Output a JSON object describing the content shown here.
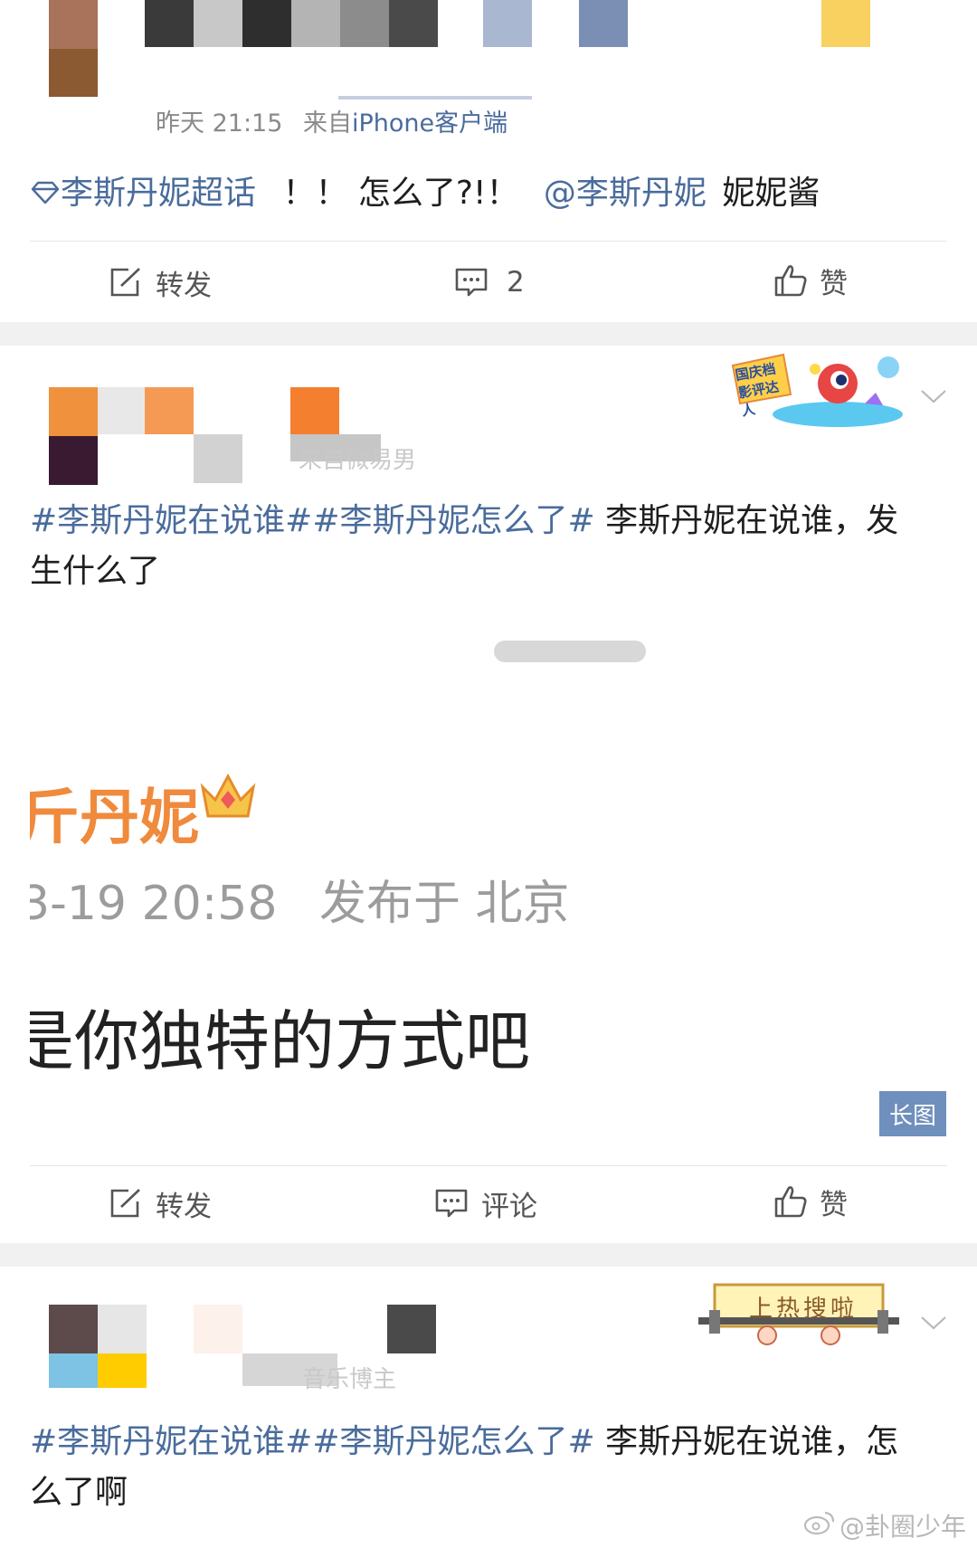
{
  "post1": {
    "meta_time": "昨天 21:15",
    "meta_from": "来自",
    "meta_client": "iPhone客户端",
    "supertopic_label": "李斯丹妮超话",
    "text_plain": "！！ 怎么了?!！",
    "mention": "@李斯丹妮",
    "text_tail": "妮妮酱",
    "actions": {
      "repost_label": "转发",
      "comment_count": "2",
      "like_label": "赞"
    }
  },
  "post2": {
    "sticker_text": "国庆档 影评达人",
    "blurred_source": "来自微易男",
    "hashtag1": "#李斯丹妮在说谁#",
    "hashtag2": "#李斯丹妮怎么了#",
    "text_line1": " 李斯丹妮在说谁，发",
    "text_line2": "生什么了",
    "embedded_image": {
      "name_fragment": "斤丹妮",
      "timestamp_fragment": "3-19 20:58",
      "location_fragment": "发布于 北京",
      "body_fragment": "是你独特的方式吧"
    },
    "long_image_badge": "长图",
    "actions": {
      "repost_label": "转发",
      "comment_label": "评论",
      "like_label": "赞"
    }
  },
  "post3": {
    "sticker_text": "上热搜啦",
    "blurred_source": "音乐博主",
    "hashtag1": "#李斯丹妮在说谁#",
    "hashtag2": "#李斯丹妮怎么了#",
    "text_line1": " 李斯丹妮在说谁，怎",
    "text_line2": "么了啊"
  },
  "watermark": "@卦圈少年",
  "colors": {
    "link_blue": "#4a6c9c",
    "badge_blue": "#6f8fbd",
    "separator": "#f1f1f1",
    "orange_name": "#f08a3c"
  }
}
